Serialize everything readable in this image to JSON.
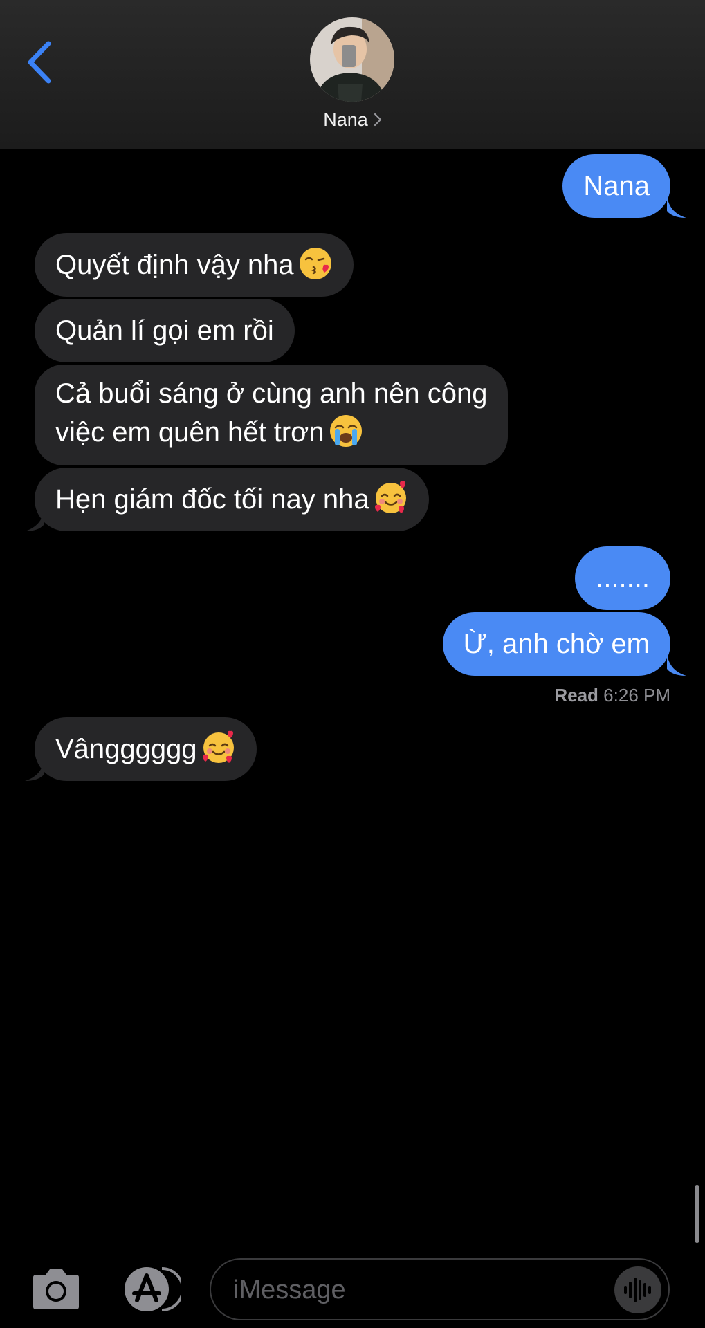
{
  "header": {
    "contact_name": "Nana",
    "back_icon": "chevron-left-icon",
    "accent_color": "#3b82f6"
  },
  "messages": [
    {
      "direction": "outgoing",
      "text": "Nana"
    },
    {
      "direction": "incoming",
      "text": "Quyết định vậy nha",
      "emoji": "kissing-face-with-heart"
    },
    {
      "direction": "incoming",
      "text": "Quản lí gọi em rồi"
    },
    {
      "direction": "incoming",
      "line1": "Cả buổi sáng ở cùng anh nên công",
      "line2": "việc em quên hết trơn",
      "emoji": "loudly-crying-face"
    },
    {
      "direction": "incoming",
      "text": "Hẹn giám đốc tối nay nha",
      "emoji": "smiling-face-with-hearts"
    },
    {
      "direction": "outgoing",
      "text": "......."
    },
    {
      "direction": "outgoing",
      "text": "Ừ, anh chờ em"
    },
    {
      "direction": "incoming",
      "text": "Vângggggg",
      "emoji": "smiling-face-with-hearts"
    }
  ],
  "read_receipt": {
    "label": "Read",
    "time": "6:26 PM"
  },
  "toolbar": {
    "camera_icon": "camera-icon",
    "appstore_icon": "app-store-icon",
    "placeholder": "iMessage",
    "audio_icon": "audio-waveform-icon"
  },
  "colors": {
    "outgoing_bubble": "#4a8af4",
    "incoming_bubble": "#262628",
    "background": "#000000"
  }
}
